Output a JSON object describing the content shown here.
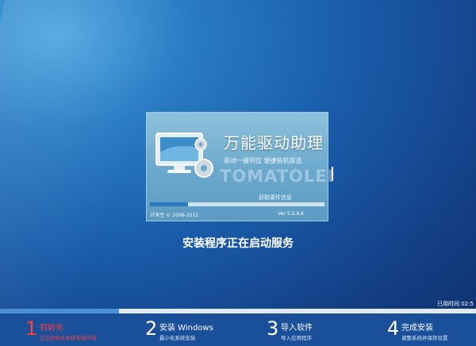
{
  "splash": {
    "title": "万能驱动助理",
    "subtitle": "驱动一键到位  便捷装机首选",
    "watermark": "TOMATOLEI",
    "status": "获取硬件信息",
    "copyright": "IT天空 © 2006-2012",
    "version": "Ver 5.2.8.6",
    "progress": 0.22
  },
  "main_status": "安装程序正在启动服务",
  "elapsed_text": "已用时间 02:5",
  "overall_progress": 0.25,
  "steps": [
    {
      "num": "1",
      "title": "初始化",
      "desc": "正在初始化系统安装环境",
      "active": true
    },
    {
      "num": "2",
      "title": "安装 Windows",
      "desc": "最小化系统安装",
      "active": false
    },
    {
      "num": "3",
      "title": "导入软件",
      "desc": "导入应用程序",
      "active": false
    },
    {
      "num": "4",
      "title": "完成安装",
      "desc": "调整系统并保存设置",
      "active": false
    }
  ],
  "colors": {
    "active_step": "#ff3d3d",
    "progress_fill": "#4a8fd6",
    "bottom_bar": "#1a4f9a"
  }
}
